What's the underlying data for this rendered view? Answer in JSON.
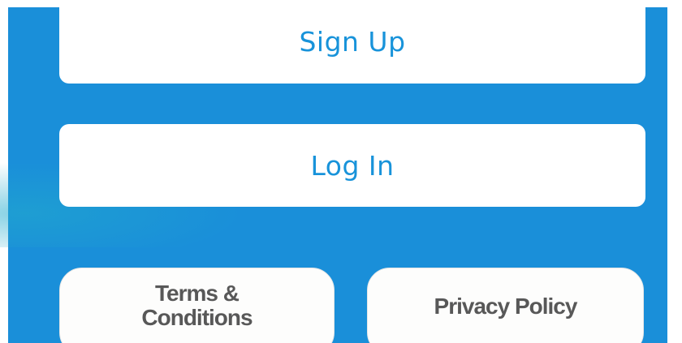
{
  "auth": {
    "signup_label": "Sign Up",
    "login_label": "Log In"
  },
  "legal": {
    "terms_label": "Terms & Conditions",
    "privacy_label": "Privacy Policy"
  },
  "colors": {
    "background": "#1a8fd9",
    "primary_text": "#1893da",
    "secondary_text": "#585858",
    "button_bg": "#ffffff"
  }
}
